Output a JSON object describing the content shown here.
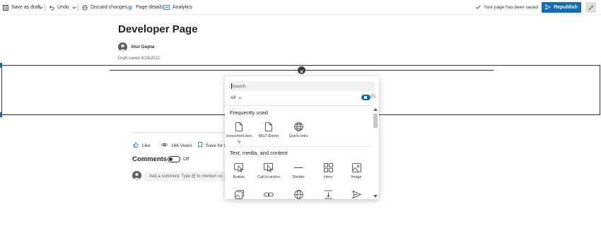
{
  "toolbar": {
    "save_as_draft": "Save as draft",
    "undo": "Undo",
    "discard_changes": "Discard changes",
    "page_details": "Page details",
    "analytics": "Analytics",
    "saved_status": "Your page has been saved",
    "republish": "Republish"
  },
  "page": {
    "title": "Developer Page",
    "author": "Atul Gupta",
    "draft_saved": "Draft saved 4/28/2022"
  },
  "social": {
    "like": "Like",
    "views": "166 Views",
    "save_for_later": "Save for la"
  },
  "comments": {
    "heading": "Comments",
    "toggle_state": "Off",
    "placeholder": "Add a comment. Type @ to mention so"
  },
  "toolbox": {
    "search_placeholder": "Search",
    "filter": "All",
    "view_extra": "EL",
    "sections": [
      {
        "title": "Frequently used",
        "items": [
          {
            "label": "consumerLibra\nry",
            "icon": "document-icon"
          },
          {
            "label": "MGT-Demo",
            "icon": "document-icon"
          },
          {
            "label": "Quick links",
            "icon": "globe-icon"
          }
        ]
      },
      {
        "title": "Text, media, and content",
        "items": [
          {
            "label": "Button",
            "icon": "button-icon"
          },
          {
            "label": "Call to action",
            "icon": "call-to-action-icon"
          },
          {
            "label": "Divider",
            "icon": "divider-icon"
          },
          {
            "label": "Hero",
            "icon": "hero-icon"
          },
          {
            "label": "Image",
            "icon": "image-icon"
          }
        ]
      }
    ],
    "partial_row_icons": [
      "image-gallery-icon",
      "link-icon",
      "globe-icon",
      "spacer-icon",
      "send-icon"
    ]
  },
  "colors": {
    "accent": "#0f6cbd",
    "text": "#323130",
    "surface": "#f3f2f1"
  }
}
